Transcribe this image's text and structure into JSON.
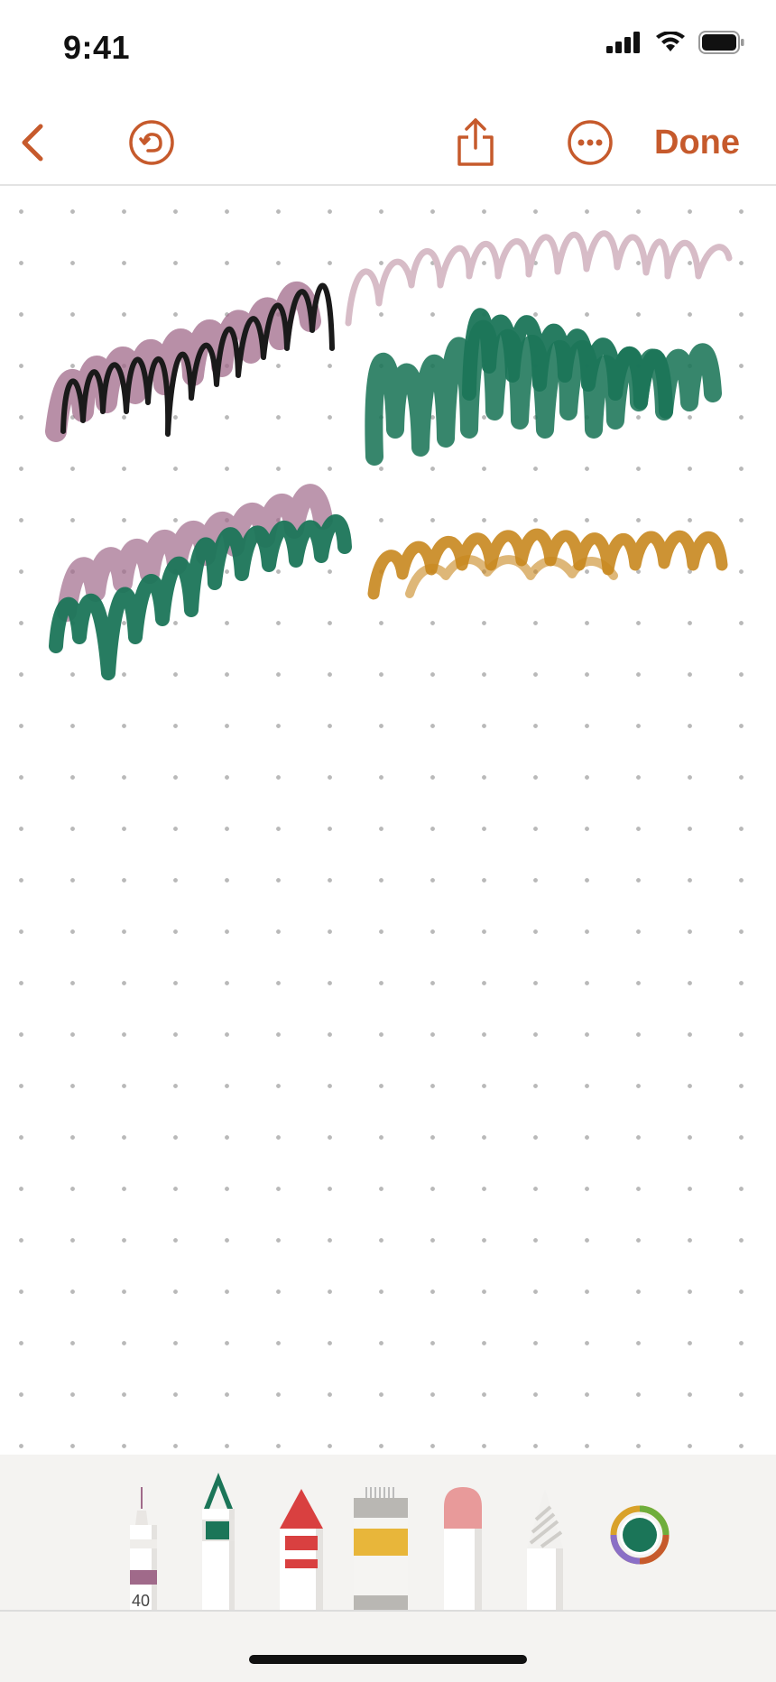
{
  "status_bar": {
    "time": "9:41"
  },
  "toolbar": {
    "done_label": "Done",
    "accent_color": "#c65a2c"
  },
  "tools": [
    {
      "name": "fineliner",
      "width_label": "40",
      "color": "#a06a8a"
    },
    {
      "name": "marker",
      "color": "#1b7558"
    },
    {
      "name": "crayon",
      "color": "#d94040"
    },
    {
      "name": "paint-tube",
      "color": "#e8b63a"
    },
    {
      "name": "eraser",
      "color": "#e89a9a"
    },
    {
      "name": "pencil-ruler",
      "color": "#d0d0d0"
    }
  ],
  "color_picker": {
    "selected_color": "#1b7558"
  },
  "drawing_colors": [
    "#1a1a1a",
    "#a06a8a",
    "#d7bcc7",
    "#1b7558",
    "#c8871e"
  ]
}
